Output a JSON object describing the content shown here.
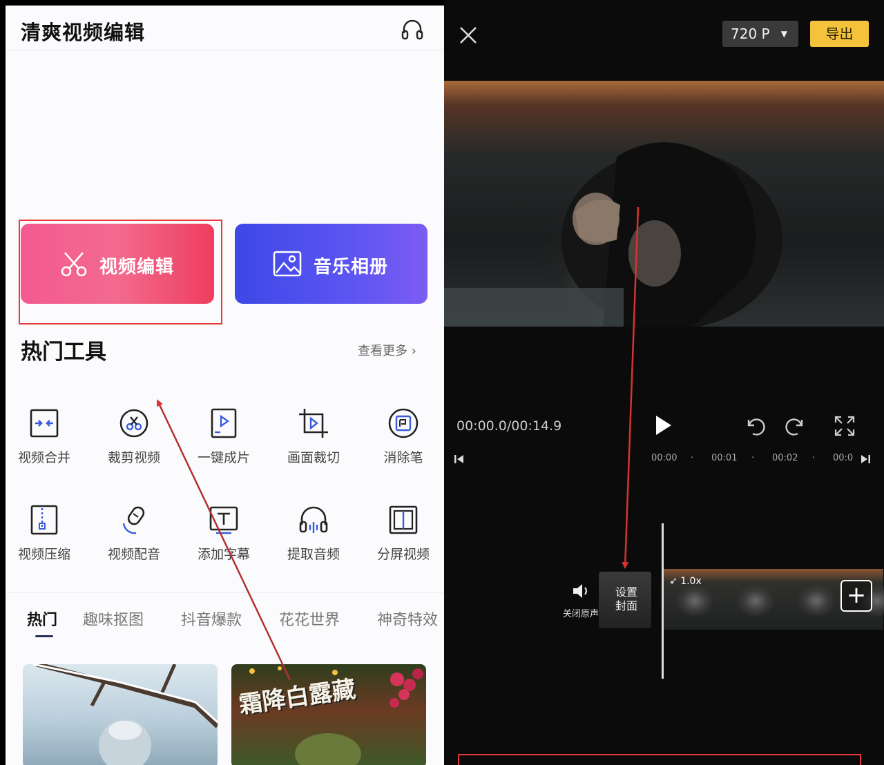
{
  "left_app": {
    "title": "清爽视频编辑",
    "support_icon": "headphones-icon",
    "feature_cards": [
      {
        "label": "视频编辑",
        "icon": "scissors-icon"
      },
      {
        "label": "音乐相册",
        "icon": "image-icon"
      }
    ],
    "hot_tools": {
      "title": "热门工具",
      "more_label": "查看更多",
      "items": [
        {
          "label": "视频合并",
          "icon": "merge-icon"
        },
        {
          "label": "裁剪视频",
          "icon": "crop-scissors-icon"
        },
        {
          "label": "一键成片",
          "icon": "video-play-icon"
        },
        {
          "label": "画面裁切",
          "icon": "frame-crop-icon"
        },
        {
          "label": "消除笔",
          "icon": "eraser-icon"
        },
        {
          "label": "视频压缩",
          "icon": "compress-icon"
        },
        {
          "label": "视频配音",
          "icon": "dub-icon"
        },
        {
          "label": "添加字幕",
          "icon": "text-icon"
        },
        {
          "label": "提取音频",
          "icon": "headphones-icon"
        },
        {
          "label": "分屏视频",
          "icon": "split-screen-icon"
        }
      ]
    },
    "category_tabs": [
      {
        "label": "热门",
        "active": true
      },
      {
        "label": "趣味抠图",
        "active": false
      },
      {
        "label": "抖音爆款",
        "active": false
      },
      {
        "label": "花花世界",
        "active": false
      },
      {
        "label": "神奇特效",
        "active": false
      }
    ],
    "template_thumbs": [
      {
        "caption": ""
      },
      {
        "caption": "霜降白露藏"
      }
    ]
  },
  "right_editor": {
    "close_icon": "close-icon",
    "resolution": "720 P",
    "export_label": "导出",
    "time_display": "00:00.0/00:14.9",
    "timeline_ticks": [
      "00:00",
      "00:01",
      "00:02",
      "00:0"
    ],
    "mute_label": "关闭原声",
    "cover_label_1": "设置",
    "cover_label_2": "封面",
    "speed_label": "1.0x",
    "add_label": "+"
  },
  "colors": {
    "highlight_red": "#e33b3b",
    "edit_card_pink": "#f2587f",
    "album_card_blue": "#4b4ff0",
    "export_yellow": "#f5c33b",
    "editor_bg": "#0b0b0b"
  }
}
